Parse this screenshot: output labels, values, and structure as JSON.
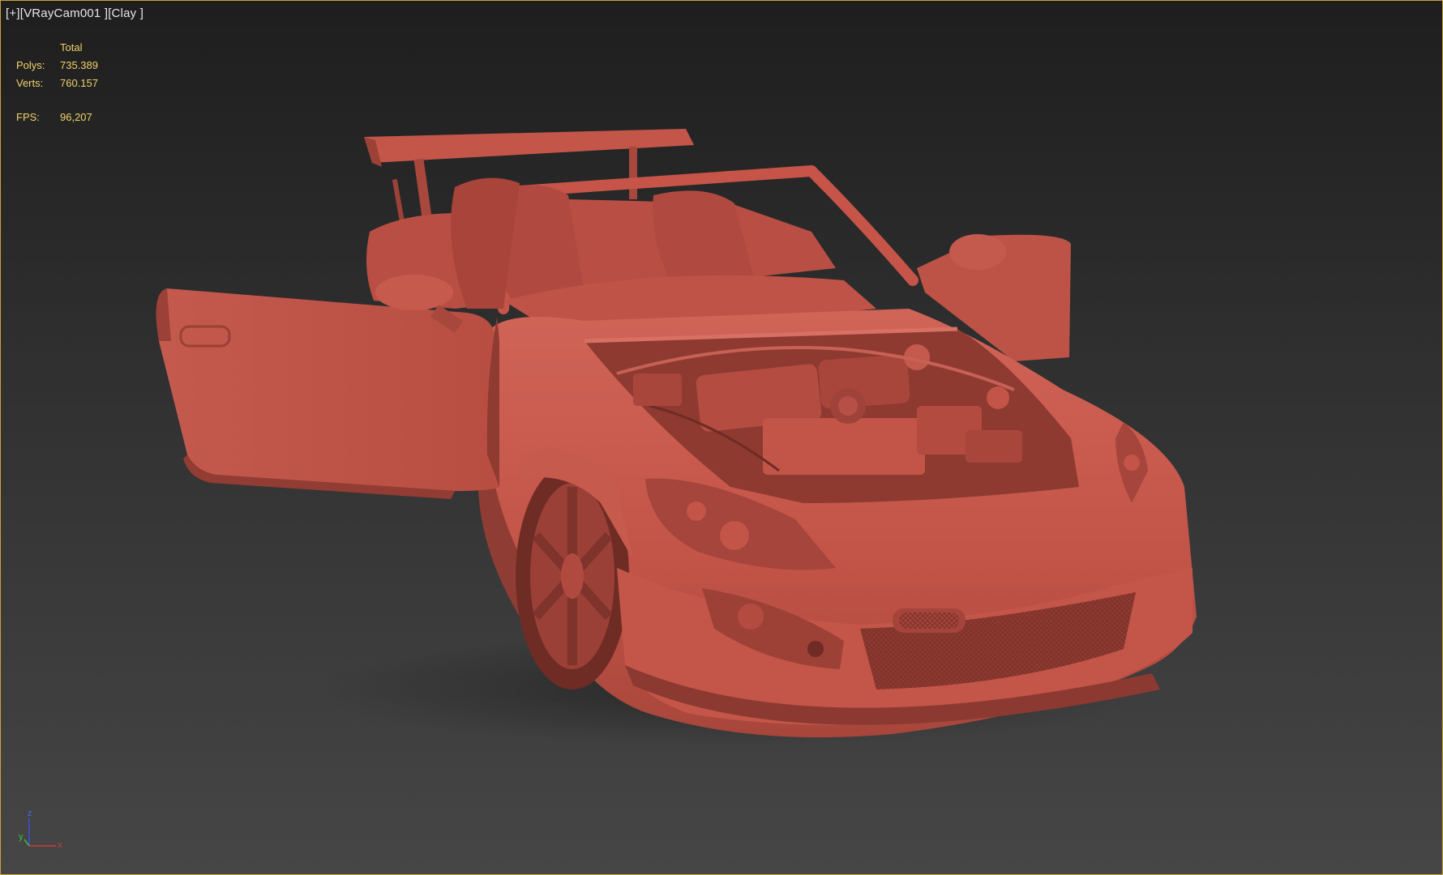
{
  "viewport": {
    "label": {
      "plus": "[+]",
      "camera": "[VRayCam001 ]",
      "shading": "[Clay ]"
    },
    "stats": {
      "header": "Total",
      "polys_label": "Polys:",
      "polys_value": "735.389",
      "verts_label": "Verts:",
      "verts_value": "760.157",
      "fps_label": "FPS:",
      "fps_value": "96,207"
    },
    "axis": {
      "z": "z",
      "y": "y",
      "x": "x"
    },
    "colors": {
      "border": "#c8a23a",
      "stats_text": "#f2d26a",
      "clay": "#c65448"
    }
  }
}
